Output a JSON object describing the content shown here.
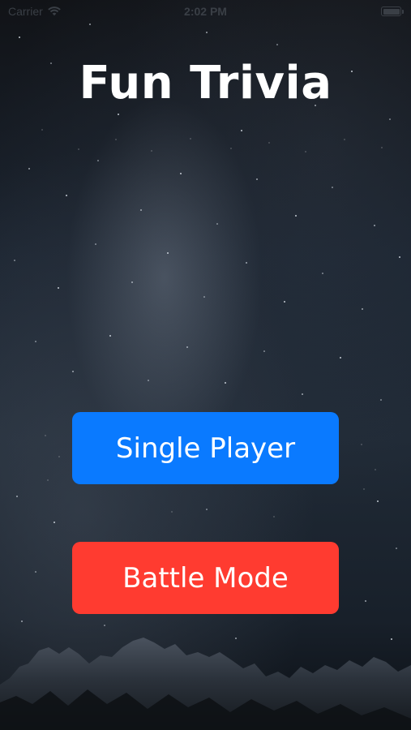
{
  "status_bar": {
    "carrier": "Carrier",
    "time": "2:02 PM",
    "wifi_icon": "wifi-icon",
    "battery_icon": "battery-icon"
  },
  "title": "Fun Trivia",
  "buttons": {
    "single_player": "Single Player",
    "battle_mode": "Battle Mode"
  },
  "colors": {
    "single_player_bg": "#0a7aff",
    "battle_mode_bg": "#ff3b30",
    "title_text": "#ffffff"
  }
}
